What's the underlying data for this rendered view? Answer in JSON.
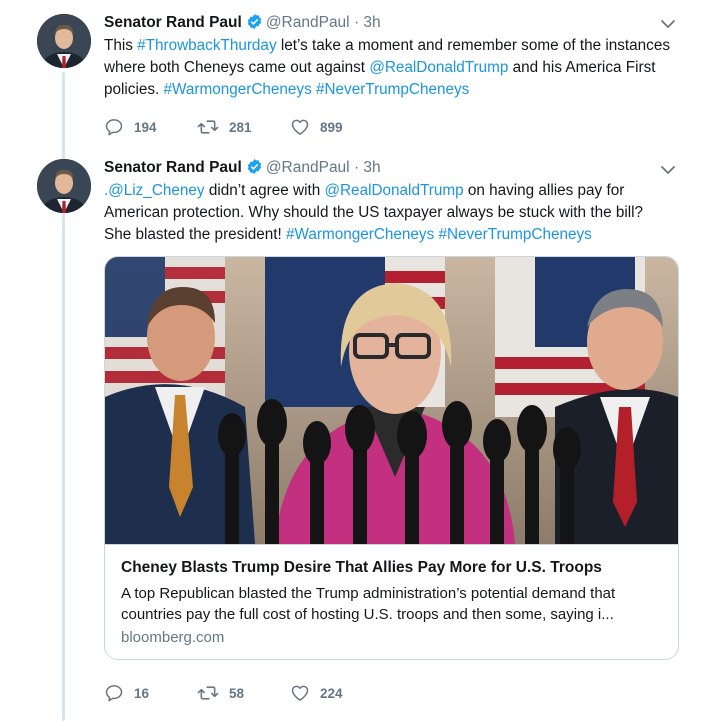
{
  "tweets": [
    {
      "name": "Senator Rand Paul",
      "handle": "@RandPaul",
      "dot": "·",
      "time": "3h",
      "text_parts": [
        {
          "t": "This ",
          "link": false
        },
        {
          "t": "#ThrowbackThurday",
          "link": true
        },
        {
          "t": " let’s take a moment and remember some of the instances where both Cheneys came out against ",
          "link": false
        },
        {
          "t": "@RealDonaldTrump",
          "link": true
        },
        {
          "t": " and his America First policies. ",
          "link": false
        },
        {
          "t": "#WarmongerCheneys",
          "link": true
        },
        {
          "t": " ",
          "link": false
        },
        {
          "t": "#NeverTrumpCheneys",
          "link": true
        }
      ],
      "replies": "194",
      "retweets": "281",
      "likes": "899"
    },
    {
      "name": "Senator Rand Paul",
      "handle": "@RandPaul",
      "dot": "·",
      "time": "3h",
      "text_parts": [
        {
          "t": ".@Liz_Cheney",
          "link": true
        },
        {
          "t": " didn’t agree with ",
          "link": false
        },
        {
          "t": "@RealDonaldTrump",
          "link": true
        },
        {
          "t": " on having allies pay for American protection. Why should the US taxpayer always be stuck with the bill? She blasted the president! ",
          "link": false
        },
        {
          "t": "#WarmongerCheneys",
          "link": true
        },
        {
          "t": " ",
          "link": false
        },
        {
          "t": "#NeverTrumpCheneys",
          "link": true
        }
      ],
      "card": {
        "title": "Cheney Blasts Trump Desire That Allies Pay More for U.S. Troops",
        "description": "A top Republican blasted the Trump administration’s potential demand that countries pay the full cost of hosting U.S. troops and then some, saying i...",
        "domain": "bloomberg.com"
      },
      "replies": "16",
      "retweets": "58",
      "likes": "224"
    }
  ],
  "colors": {
    "link": "#1b95e0",
    "secondary": "#657786",
    "thread_line": "#d6e6ee",
    "border": "#ccd6dd"
  }
}
